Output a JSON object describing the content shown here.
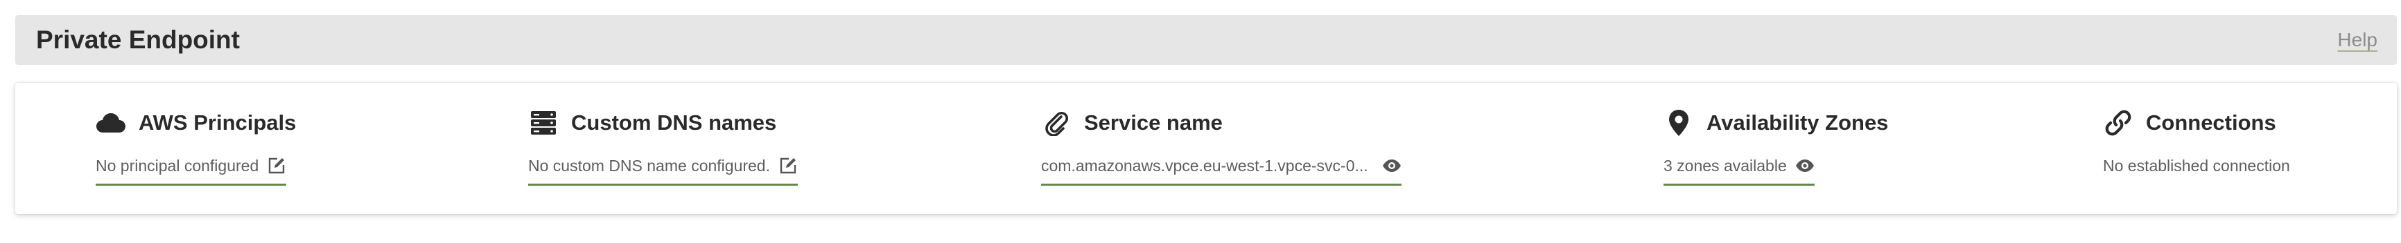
{
  "header": {
    "title": "Private Endpoint",
    "help_label": "Help"
  },
  "items": [
    {
      "icon": "cloud-icon",
      "title": "AWS Principals",
      "value": "No principal configured",
      "action_icon": "edit-icon"
    },
    {
      "icon": "server-icon",
      "title": "Custom DNS names",
      "value": "No custom DNS name configured.",
      "action_icon": "edit-icon"
    },
    {
      "icon": "paperclip-icon",
      "title": "Service name",
      "value": "com.amazonaws.vpce.eu-west-1.vpce-svc-0...",
      "action_icon": "eye-icon"
    },
    {
      "icon": "map-pin-icon",
      "title": "Availability Zones",
      "value": "3 zones available",
      "action_icon": "eye-icon"
    },
    {
      "icon": "link-icon",
      "title": "Connections",
      "value": "No established connection"
    }
  ],
  "colors": {
    "header_bg": "#e6e6e6",
    "underline_green": "#5f8e3e",
    "text_dark": "#2a2a2a",
    "text_muted": "#5e5e5e"
  }
}
